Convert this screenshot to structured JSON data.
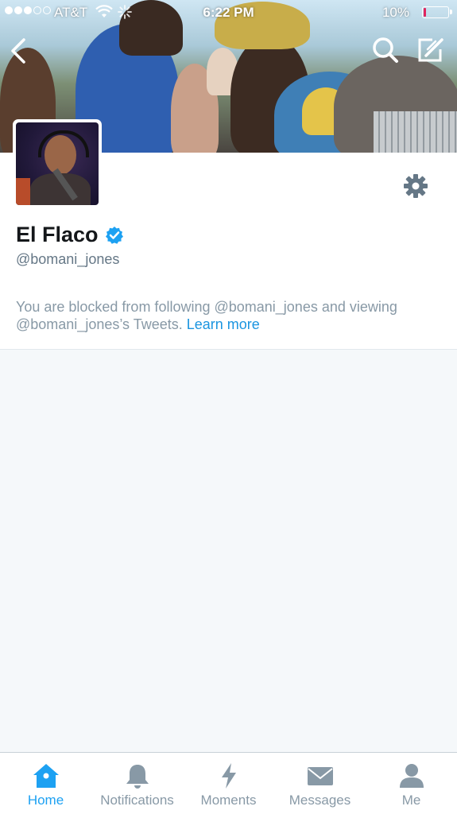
{
  "status_bar": {
    "carrier": "AT&T",
    "time": "6:22 PM",
    "battery_percent": "10%",
    "battery_level": 0.1,
    "signal_bars_filled": 3,
    "signal_bars_total": 5
  },
  "profile": {
    "name": "El Flaco",
    "handle": "@bomani_jones",
    "verified": true
  },
  "notice": {
    "text": "You are blocked from following @bomani_jones and viewing @bomani_jones’s Tweets. ",
    "link": "Learn more"
  },
  "tabs": [
    {
      "label": "Home",
      "icon": "home-icon",
      "active": true
    },
    {
      "label": "Notifications",
      "icon": "bell-icon",
      "active": false
    },
    {
      "label": "Moments",
      "icon": "lightning-icon",
      "active": false
    },
    {
      "label": "Messages",
      "icon": "envelope-icon",
      "active": false
    },
    {
      "label": "Me",
      "icon": "person-icon",
      "active": false
    }
  ],
  "colors": {
    "accent": "#1da1f2",
    "link": "#1b95e0",
    "muted": "#8899a6",
    "verified": "#1da1f2",
    "battery_low": "#e0245e"
  }
}
